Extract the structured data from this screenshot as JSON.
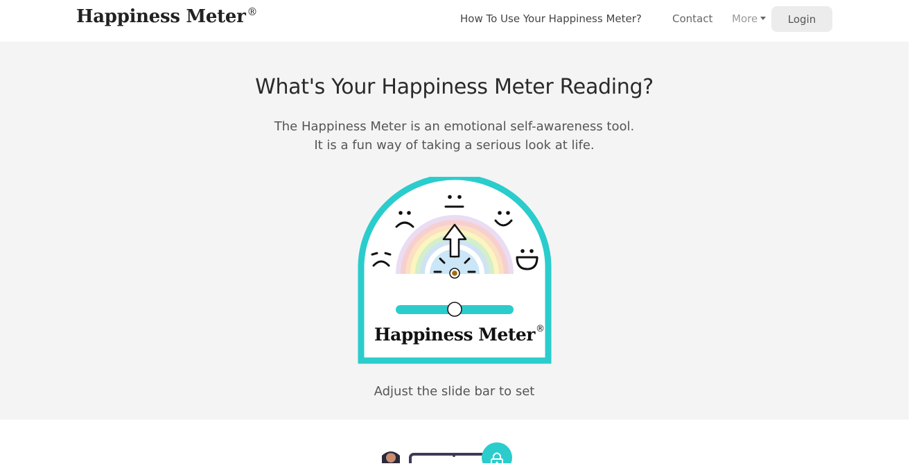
{
  "nav": {
    "brand": "Happiness Meter",
    "brand_mark": "®",
    "links": {
      "how_to": "How To Use Your Happiness Meter?",
      "contact": "Contact",
      "more": "More"
    },
    "login": "Login"
  },
  "hero": {
    "title": "What's Your Happiness Meter Reading?",
    "lead_line1": "The Happiness Meter is an emotional self-awareness tool.",
    "lead_line2": "It is a fun way of taking a serious look at life.",
    "hint": "Adjust the slide bar to set"
  },
  "meter": {
    "logo_text": "Happiness Meter",
    "logo_mark": "®",
    "slider_value": 0.5,
    "faces": [
      "very-sad-face-icon",
      "sad-face-icon",
      "neutral-face-icon",
      "happy-face-icon",
      "very-happy-face-icon"
    ]
  },
  "colors": {
    "teal": "#2bcccc",
    "hero_bg": "#f4f4f4",
    "login_bg": "#ececec"
  }
}
